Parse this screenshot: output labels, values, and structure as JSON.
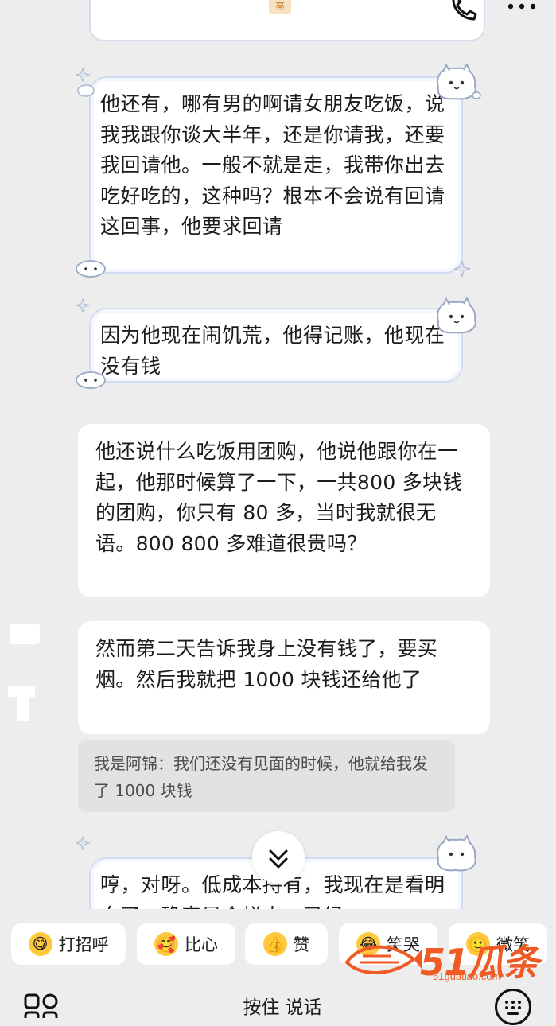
{
  "header": {
    "contact_avatar_text": "亮",
    "phone_icon": "phone-icon",
    "more_icon": "more-icon"
  },
  "messages": [
    {
      "text": "他还有，哪有男的啊请女朋友吃饭，说我我跟你谈大半年，还是你请我，还要我回请他。一般不就是走，我带你出去吃好吃的，这种吗？根本不会说有回请这回事，他要求回请"
    },
    {
      "text": "因为他现在闹饥荒，他得记账，他现在没有钱"
    },
    {
      "text": "他还说什么吃饭用团购，他说他跟你在一起，他那时候算了一下，一共800 多块钱的团购，你只有 80 多，当时我就很无语。800 800 多难道很贵吗？"
    },
    {
      "text": "然而第二天告诉我身上没有钱了，要买烟。然后我就把 1000 块钱还给他了"
    },
    {
      "text": "我是阿锦：我们还没有见面的时候，他就给我发了 1000 块钱"
    },
    {
      "text": "哼，对呀。低成本持有，我现在是看明白了，确实是个烂人，已经"
    }
  ],
  "scroll_down_icon": "chevron-double-down-icon",
  "quick_replies": [
    {
      "label": "打招呼",
      "icon": "hello-emoji-icon"
    },
    {
      "label": "比心",
      "icon": "heart-hands-emoji-icon"
    },
    {
      "label": "赞",
      "icon": "thumbs-up-icon"
    },
    {
      "label": "笑哭",
      "icon": "tears-of-joy-emoji-icon"
    },
    {
      "label": "微笑",
      "icon": "smile-emoji-icon"
    }
  ],
  "input": {
    "hold_to_talk": "按住 说话",
    "apps_icon": "apps-grid-icon",
    "keyboard_icon": "keyboard-icon"
  },
  "watermark": {
    "brand": "51瓜条",
    "url": "51guatiao.com"
  }
}
